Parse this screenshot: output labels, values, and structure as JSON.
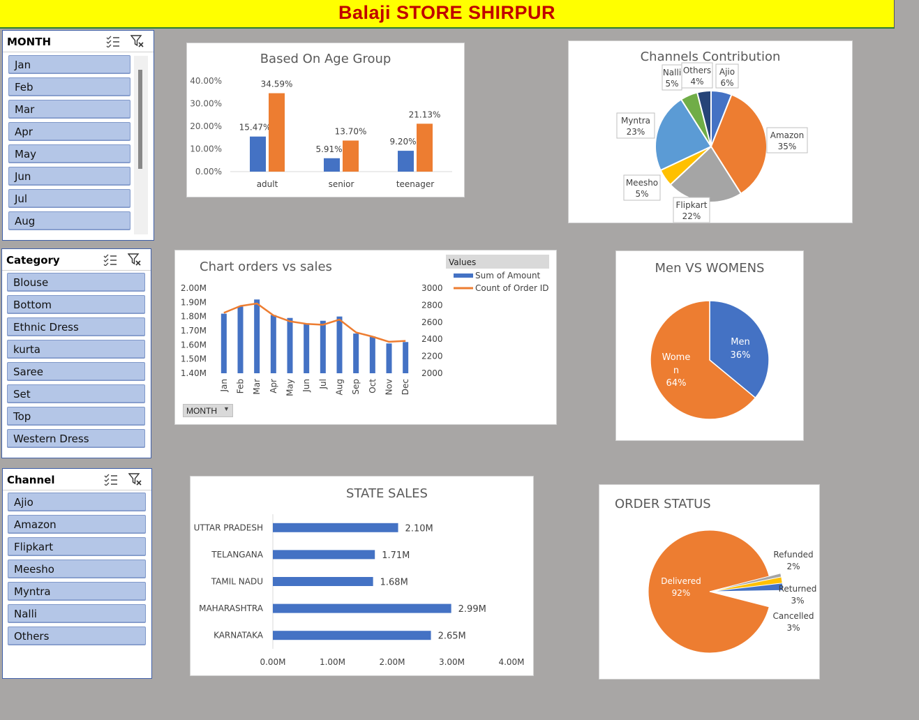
{
  "banner": {
    "title": "Balaji STORE SHIRPUR"
  },
  "slicers": {
    "month": {
      "title": "MONTH",
      "items": [
        "Jan",
        "Feb",
        "Mar",
        "Apr",
        "May",
        "Jun",
        "Jul",
        "Aug"
      ]
    },
    "category": {
      "title": "Category",
      "items": [
        "Blouse",
        "Bottom",
        "Ethnic Dress",
        "kurta",
        "Saree",
        "Set",
        "Top",
        "Western Dress"
      ]
    },
    "channel": {
      "title": "Channel",
      "items": [
        "Ajio",
        "Amazon",
        "Flipkart",
        "Meesho",
        "Myntra",
        "Nalli",
        "Others"
      ]
    }
  },
  "colors": {
    "blue": "#4472c4",
    "orange": "#ed7d31",
    "gray": "#a5a5a5",
    "gold": "#ffc000",
    "lightblue": "#5b9bd5",
    "green": "#70ad47",
    "navy": "#264478",
    "accent_yellow": "#ffff00",
    "title_red": "#c00000"
  },
  "charts": {
    "age": {
      "title": "Based On Age Group"
    },
    "channels": {
      "title": "Channels Contribution"
    },
    "orders": {
      "title": "Chart orders vs sales",
      "filter_label": "MONTH",
      "legend_title": "Values"
    },
    "gender": {
      "title": "Men VS WOMENS"
    },
    "state": {
      "title": "STATE SALES"
    },
    "status": {
      "title": "ORDER STATUS"
    }
  },
  "chart_data": [
    {
      "id": "age",
      "type": "bar",
      "title": "Based On Age Group",
      "categories": [
        "adult",
        "senior",
        "teenager"
      ],
      "series": [
        {
          "values": [
            15.47,
            5.91,
            9.2
          ],
          "labels": [
            "15.47%",
            "5.91%",
            "9.20%"
          ]
        },
        {
          "values": [
            34.59,
            13.7,
            21.13
          ],
          "labels": [
            "34.59%",
            "13.70%",
            "21.13%"
          ]
        }
      ],
      "yticks": [
        "0.00%",
        "10.00%",
        "20.00%",
        "30.00%",
        "40.00%"
      ],
      "ylim": [
        0,
        40
      ]
    },
    {
      "id": "channels",
      "type": "pie",
      "title": "Channels Contribution",
      "slices": [
        {
          "name": "Ajio",
          "value": 6,
          "label": "6%"
        },
        {
          "name": "Amazon",
          "value": 35,
          "label": "35%"
        },
        {
          "name": "Flipkart",
          "value": 22,
          "label": "22%"
        },
        {
          "name": "Meesho",
          "value": 5,
          "label": "5%"
        },
        {
          "name": "Myntra",
          "value": 23,
          "label": "23%"
        },
        {
          "name": "Nalli",
          "value": 5,
          "label": "5%"
        },
        {
          "name": "Others",
          "value": 4,
          "label": "4%"
        }
      ]
    },
    {
      "id": "orders",
      "type": "bar",
      "title": "Chart orders vs sales",
      "categories": [
        "Jan",
        "Feb",
        "Mar",
        "Apr",
        "May",
        "Jun",
        "Jul",
        "Aug",
        "Sep",
        "Oct",
        "Nov",
        "Dec"
      ],
      "series": [
        {
          "name": "Sum of Amount",
          "type": "bar",
          "values": [
            1.82,
            1.87,
            1.92,
            1.81,
            1.79,
            1.75,
            1.77,
            1.8,
            1.68,
            1.66,
            1.61,
            1.62
          ]
        },
        {
          "name": "Count of Order ID",
          "type": "line",
          "values": [
            2710,
            2790,
            2820,
            2680,
            2610,
            2580,
            2570,
            2630,
            2480,
            2430,
            2370,
            2380
          ]
        }
      ],
      "y_left_ticks": [
        "1.40M",
        "1.50M",
        "1.60M",
        "1.70M",
        "1.80M",
        "1.90M",
        "2.00M"
      ],
      "ylim_left": [
        1.4,
        2.0
      ],
      "y_right_ticks": [
        "2000",
        "2200",
        "2400",
        "2600",
        "2800",
        "3000"
      ],
      "ylim_right": [
        2000,
        3000
      ]
    },
    {
      "id": "gender",
      "type": "pie",
      "title": "Men VS WOMENS",
      "slices": [
        {
          "name": "Men",
          "value": 36,
          "label": "36%"
        },
        {
          "name": "Women",
          "value": 64,
          "label": "64%"
        }
      ]
    },
    {
      "id": "state",
      "type": "bar",
      "orientation": "horizontal",
      "title": "STATE SALES",
      "categories": [
        "UTTAR PRADESH",
        "TELANGANA",
        "TAMIL NADU",
        "MAHARASHTRA",
        "KARNATAKA"
      ],
      "values": [
        2.1,
        1.71,
        1.68,
        2.99,
        2.65
      ],
      "labels": [
        "2.10M",
        "1.71M",
        "1.68M",
        "2.99M",
        "2.65M"
      ],
      "xticks": [
        "0.00M",
        "1.00M",
        "2.00M",
        "3.00M",
        "4.00M"
      ],
      "xlim": [
        0,
        4
      ]
    },
    {
      "id": "status",
      "type": "pie",
      "title": "ORDER STATUS",
      "slices": [
        {
          "name": "Delivered",
          "value": 92,
          "label": "92%"
        },
        {
          "name": "Refunded",
          "value": 2,
          "label": "2%"
        },
        {
          "name": "Returned",
          "value": 3,
          "label": "3%"
        },
        {
          "name": "Cancelled",
          "value": 3,
          "label": "3%"
        }
      ]
    }
  ]
}
